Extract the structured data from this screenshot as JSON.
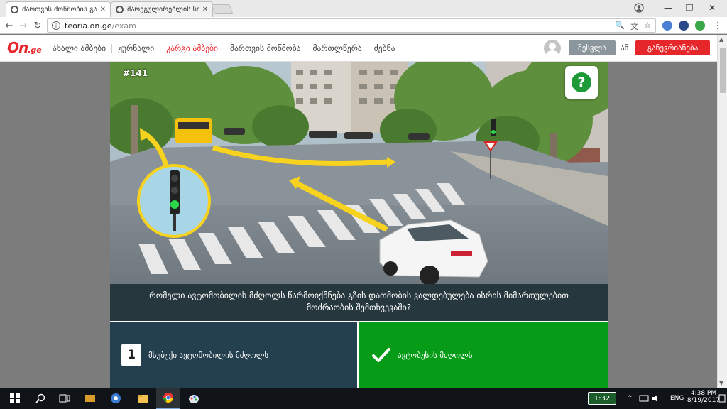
{
  "browser": {
    "tabs": [
      {
        "title": "მართვის მოწმობის გამოცდა",
        "active": true
      },
      {
        "title": "მარეგულირებლის სიგნალები",
        "active": false
      }
    ],
    "close_glyph": "✕",
    "window_controls": {
      "minimize": "—",
      "restore": "❐",
      "close": "✕"
    },
    "back_glyph": "←",
    "forward_glyph": "→",
    "reload_glyph": "↻",
    "info_glyph": "i",
    "url_host": "teoria.on.ge",
    "url_path": "/exam",
    "omni_icons": {
      "zoom": "🔍",
      "translate": "文",
      "star": "☆"
    },
    "menu_glyph": "⋮",
    "profile_glyph": "◉"
  },
  "site": {
    "logo_on": "On",
    "logo_ge": ".ge",
    "nav": [
      {
        "label": "ახალი ამბები",
        "active": false
      },
      {
        "label": "ჟურნალი",
        "active": false
      },
      {
        "label": "კარგი ამბები",
        "active": true
      },
      {
        "label": "მართვის მოწმობა",
        "active": false
      },
      {
        "label": "მართლწერა",
        "active": false
      },
      {
        "label": "ძებნა",
        "active": false
      }
    ],
    "login_label": "შესვლა",
    "or_label": "ან",
    "register_label": "განევრიანება"
  },
  "exam": {
    "question_number": "#141",
    "help_glyph": "?",
    "question_text": "რომელი ავტომობილის მძღოლს წარმოიქმნება გზის დათმობის ვალდებულება ისრის მიმართულებით მოძრაობის შემთხვევაში?",
    "answers": [
      {
        "number": "1",
        "label": "მსუბუქი ავტომობილის მძღოლს",
        "state": "neutral"
      },
      {
        "number": "",
        "label": "ავტობუსის მძღოლს",
        "state": "correct"
      }
    ]
  },
  "taskbar": {
    "start_icon": "windows-icon",
    "battery": "1:32",
    "language": "ENG",
    "time": "4:38 PM",
    "date": "8/19/2017",
    "tray_chevron": "^"
  },
  "colors": {
    "brand_red": "#e5262a",
    "login_gray": "#8b969c",
    "correct_green": "#079c18",
    "answer_dark": "#243f4d",
    "question_bg": "#26373e",
    "help_green": "#1e9b37"
  }
}
